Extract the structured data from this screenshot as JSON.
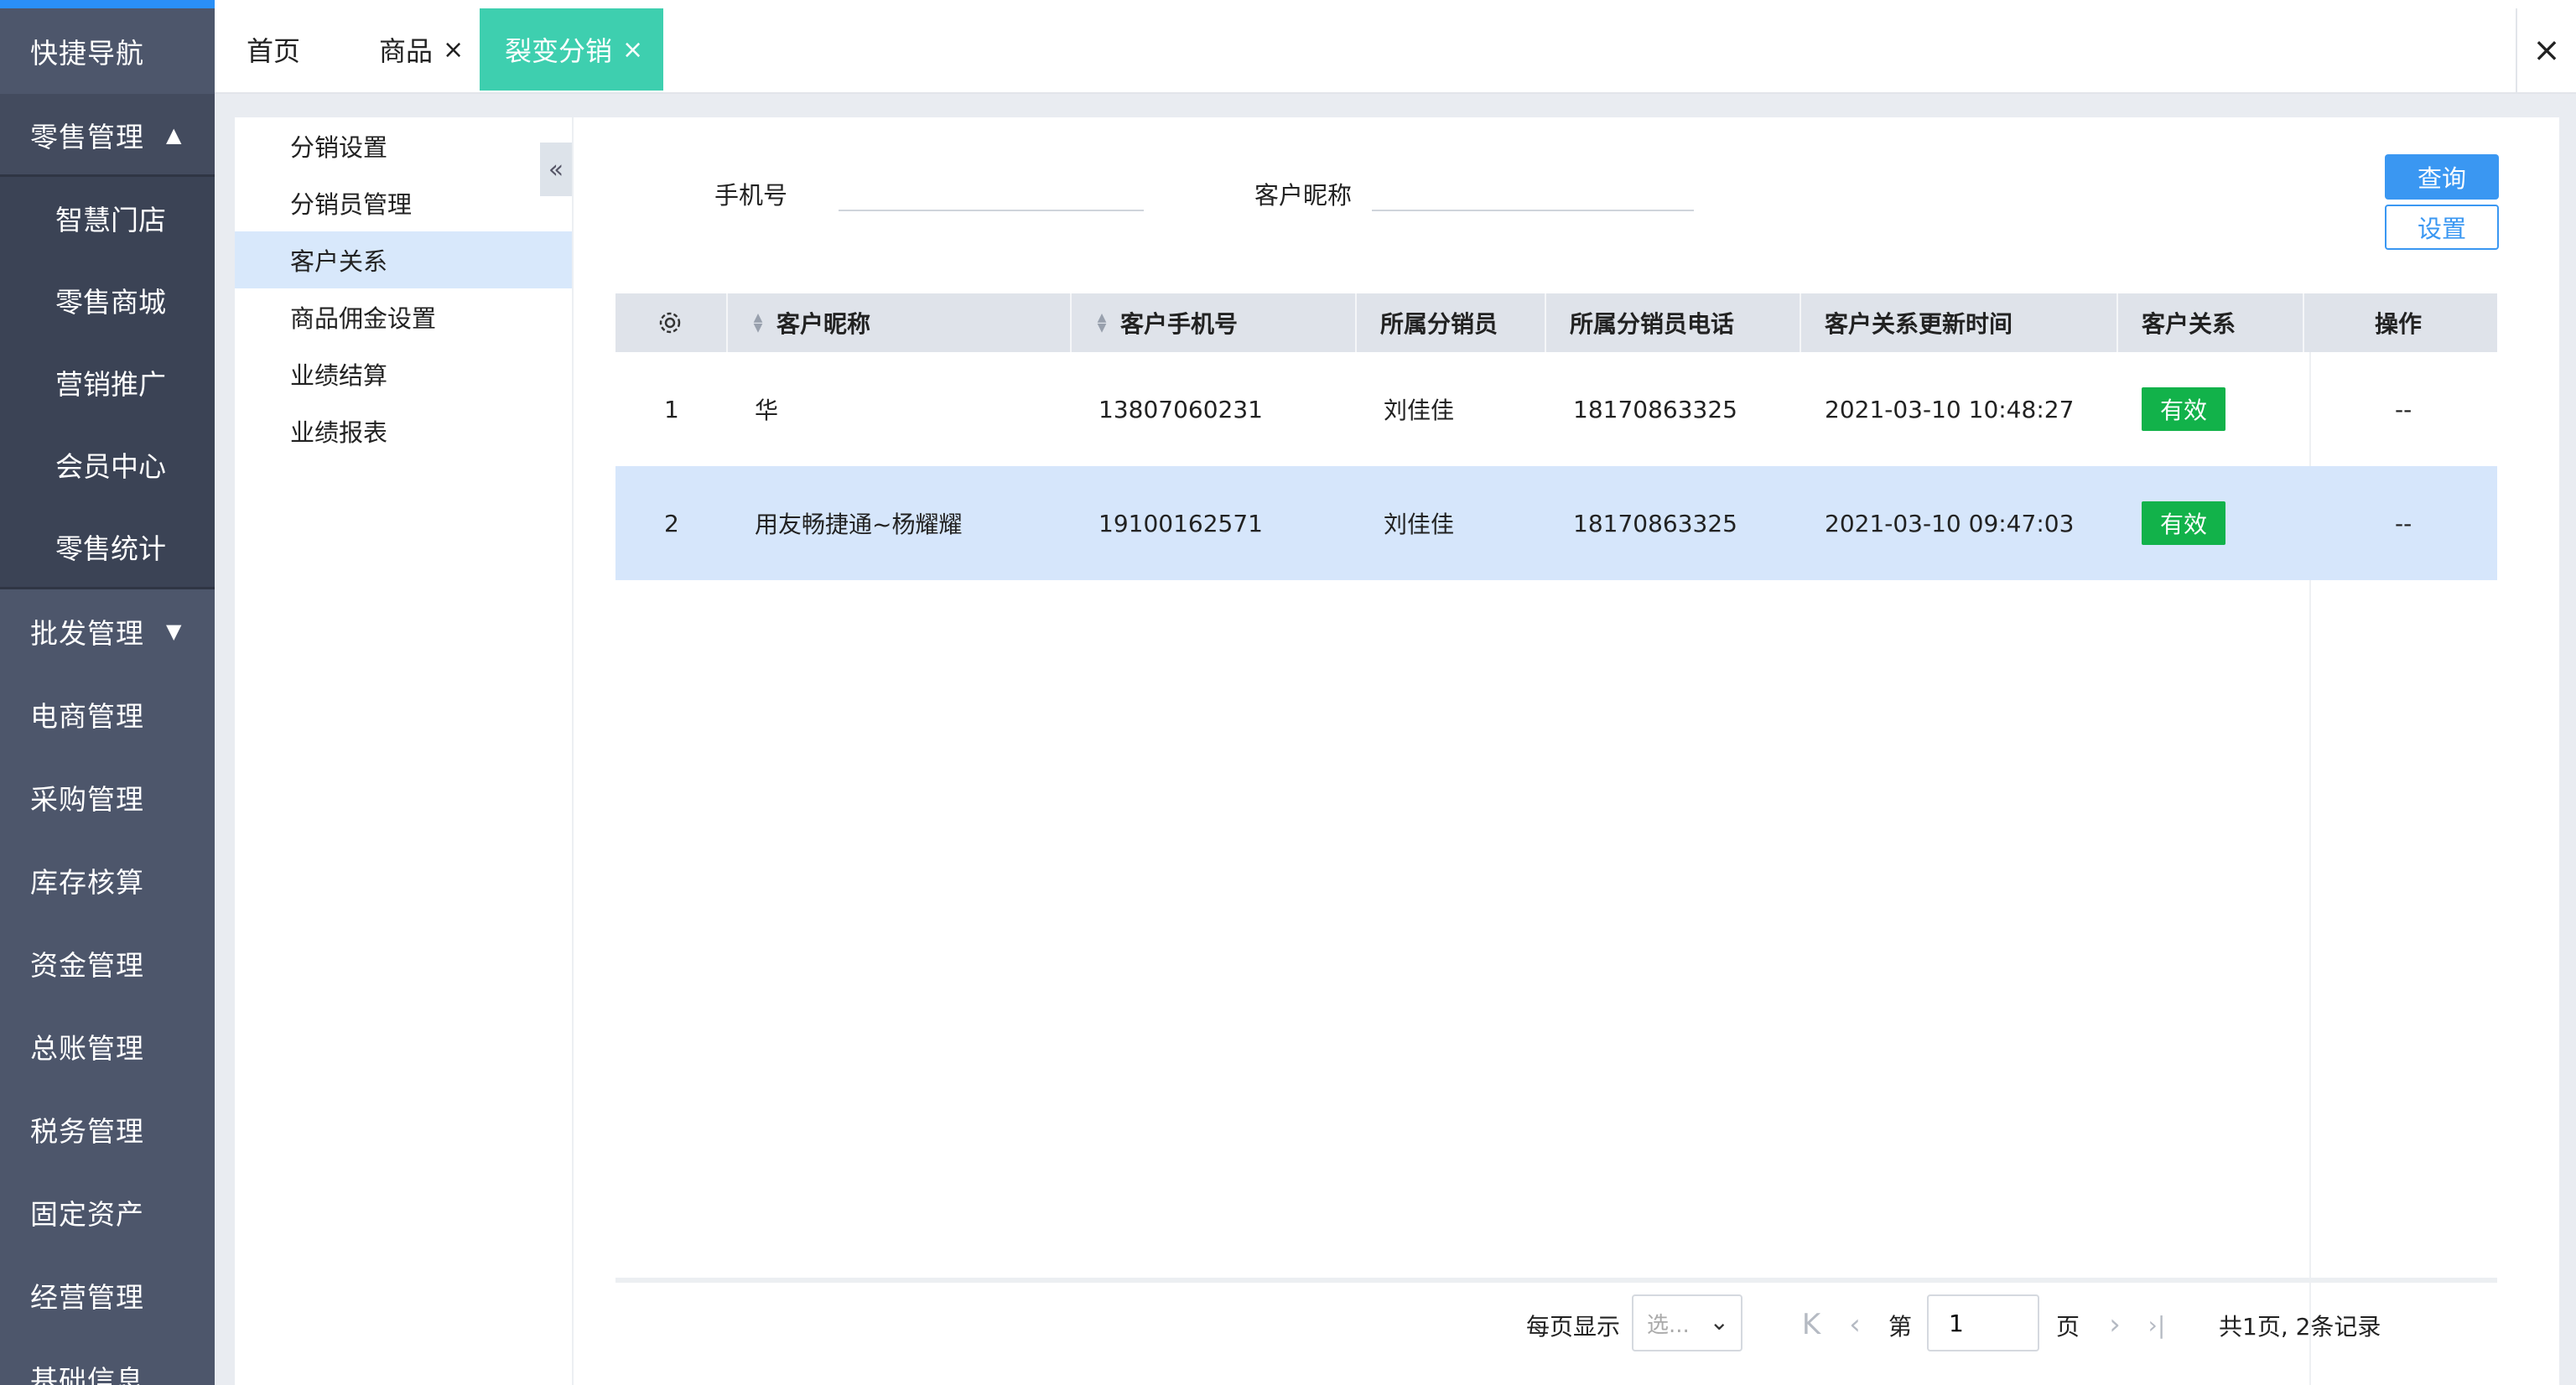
{
  "nav": {
    "items": [
      {
        "label": "快捷导航"
      },
      {
        "label": "零售管理",
        "caret": "▲"
      },
      {
        "label": "智慧门店"
      },
      {
        "label": "零售商城"
      },
      {
        "label": "营销推广"
      },
      {
        "label": "会员中心"
      },
      {
        "label": "零售统计"
      },
      {
        "label": "批发管理",
        "caret": "▼"
      },
      {
        "label": "电商管理"
      },
      {
        "label": "采购管理"
      },
      {
        "label": "库存核算"
      },
      {
        "label": "资金管理"
      },
      {
        "label": "总账管理"
      },
      {
        "label": "税务管理"
      },
      {
        "label": "固定资产"
      },
      {
        "label": "经营管理"
      },
      {
        "label": "基础信息"
      }
    ]
  },
  "tabs": [
    {
      "label": "首页"
    },
    {
      "label": "商品",
      "close": "×"
    },
    {
      "label": "裂变分销",
      "close": "×"
    }
  ],
  "tabbar_close": "×",
  "submenu": {
    "collapse": "«",
    "items": [
      {
        "label": "分销设置"
      },
      {
        "label": "分销员管理"
      },
      {
        "label": "客户关系"
      },
      {
        "label": "商品佣金设置"
      },
      {
        "label": "业绩结算"
      },
      {
        "label": "业绩报表"
      }
    ]
  },
  "filters": {
    "phone_label": "手机号",
    "phone_value": "",
    "nickname_label": "客户昵称",
    "nickname_value": ""
  },
  "buttons": {
    "query": "查询",
    "setting": "设置"
  },
  "table": {
    "headers": [
      "客户昵称",
      "客户手机号",
      "所属分销员",
      "所属分销员电话",
      "客户关系更新时间",
      "客户关系",
      "操作"
    ],
    "rows": [
      {
        "no": "1",
        "nickname": "华",
        "phone": "13807060231",
        "distributor": "刘佳佳",
        "distributor_phone": "18170863325",
        "updated": "2021-03-10 10:48:27",
        "status": "有效",
        "action": "--"
      },
      {
        "no": "2",
        "nickname": "用友畅捷通~杨耀耀",
        "phone": "19100162571",
        "distributor": "刘佳佳",
        "distributor_phone": "18170863325",
        "updated": "2021-03-10 09:47:03",
        "status": "有效",
        "action": "--"
      }
    ]
  },
  "pager": {
    "per_page_label": "每页显示",
    "per_page_placeholder": "选...",
    "first": "K",
    "prev": "‹",
    "page_prefix": "第",
    "page_value": "1",
    "page_suffix": "页",
    "next": "›",
    "last": "›|",
    "summary": "共1页, 2条记录"
  },
  "colors": {
    "accent": "#2a8ff7",
    "active_tab": "#3ecfaf",
    "status_ok": "#12b24a",
    "nav_bg": "#4d566b"
  }
}
